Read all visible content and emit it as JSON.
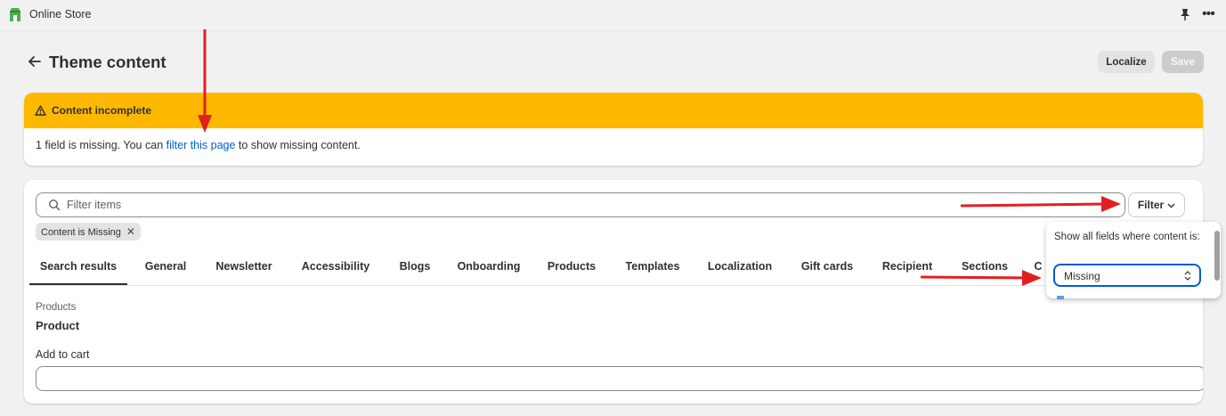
{
  "appbar": {
    "app_name": "Online Store",
    "logo_icon": "online-store-icon",
    "pin_icon": "pin-icon",
    "more_icon": "more-horizontal-icon"
  },
  "header": {
    "title": "Theme content",
    "back_icon": "arrow-left-icon"
  },
  "actions": {
    "localize_label": "Localize",
    "save_label": "Save"
  },
  "banner": {
    "title": "Content incomplete",
    "icon": "warning-icon",
    "text_before": "1 field is missing. You can ",
    "link_text": "filter this page",
    "text_after": " to show missing content.",
    "color": "#ffb800"
  },
  "search": {
    "placeholder": "Filter items",
    "icon": "search-icon"
  },
  "filter_button": {
    "label": "Filter"
  },
  "applied_filter": {
    "label": "Content is Missing"
  },
  "tabs": [
    {
      "label": "Search results",
      "active": true
    },
    {
      "label": "General"
    },
    {
      "label": "Newsletter"
    },
    {
      "label": "Accessibility"
    },
    {
      "label": "Blogs"
    },
    {
      "label": "Onboarding"
    },
    {
      "label": "Products"
    },
    {
      "label": "Templates"
    },
    {
      "label": "Localization"
    },
    {
      "label": "Gift cards"
    },
    {
      "label": "Recipient"
    },
    {
      "label": "Sections"
    },
    {
      "label": "C"
    }
  ],
  "content": {
    "section_label": "Products",
    "section_title": "Product",
    "field_label": "Add to cart",
    "field_value": ""
  },
  "popover": {
    "text": "Show all fields where content is:",
    "select_value": "Missing"
  },
  "colors": {
    "link": "#005bd3",
    "annotation_arrow": "#e02020"
  }
}
